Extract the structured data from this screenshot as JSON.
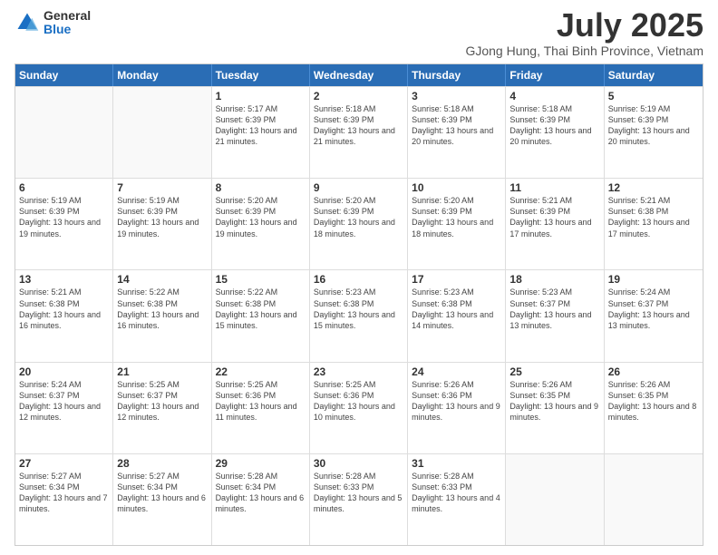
{
  "logo": {
    "general": "General",
    "blue": "Blue"
  },
  "title": {
    "month_year": "July 2025",
    "location": "GJong Hung, Thai Binh Province, Vietnam"
  },
  "header_days": [
    "Sunday",
    "Monday",
    "Tuesday",
    "Wednesday",
    "Thursday",
    "Friday",
    "Saturday"
  ],
  "weeks": [
    [
      {
        "day": "",
        "empty": true
      },
      {
        "day": "",
        "empty": true
      },
      {
        "day": "1",
        "sunrise": "5:17 AM",
        "sunset": "6:39 PM",
        "daylight": "13 hours and 21 minutes."
      },
      {
        "day": "2",
        "sunrise": "5:18 AM",
        "sunset": "6:39 PM",
        "daylight": "13 hours and 21 minutes."
      },
      {
        "day": "3",
        "sunrise": "5:18 AM",
        "sunset": "6:39 PM",
        "daylight": "13 hours and 20 minutes."
      },
      {
        "day": "4",
        "sunrise": "5:18 AM",
        "sunset": "6:39 PM",
        "daylight": "13 hours and 20 minutes."
      },
      {
        "day": "5",
        "sunrise": "5:19 AM",
        "sunset": "6:39 PM",
        "daylight": "13 hours and 20 minutes."
      }
    ],
    [
      {
        "day": "6",
        "sunrise": "5:19 AM",
        "sunset": "6:39 PM",
        "daylight": "13 hours and 19 minutes."
      },
      {
        "day": "7",
        "sunrise": "5:19 AM",
        "sunset": "6:39 PM",
        "daylight": "13 hours and 19 minutes."
      },
      {
        "day": "8",
        "sunrise": "5:20 AM",
        "sunset": "6:39 PM",
        "daylight": "13 hours and 19 minutes."
      },
      {
        "day": "9",
        "sunrise": "5:20 AM",
        "sunset": "6:39 PM",
        "daylight": "13 hours and 18 minutes."
      },
      {
        "day": "10",
        "sunrise": "5:20 AM",
        "sunset": "6:39 PM",
        "daylight": "13 hours and 18 minutes."
      },
      {
        "day": "11",
        "sunrise": "5:21 AM",
        "sunset": "6:39 PM",
        "daylight": "13 hours and 17 minutes."
      },
      {
        "day": "12",
        "sunrise": "5:21 AM",
        "sunset": "6:38 PM",
        "daylight": "13 hours and 17 minutes."
      }
    ],
    [
      {
        "day": "13",
        "sunrise": "5:21 AM",
        "sunset": "6:38 PM",
        "daylight": "13 hours and 16 minutes."
      },
      {
        "day": "14",
        "sunrise": "5:22 AM",
        "sunset": "6:38 PM",
        "daylight": "13 hours and 16 minutes."
      },
      {
        "day": "15",
        "sunrise": "5:22 AM",
        "sunset": "6:38 PM",
        "daylight": "13 hours and 15 minutes."
      },
      {
        "day": "16",
        "sunrise": "5:23 AM",
        "sunset": "6:38 PM",
        "daylight": "13 hours and 15 minutes."
      },
      {
        "day": "17",
        "sunrise": "5:23 AM",
        "sunset": "6:38 PM",
        "daylight": "13 hours and 14 minutes."
      },
      {
        "day": "18",
        "sunrise": "5:23 AM",
        "sunset": "6:37 PM",
        "daylight": "13 hours and 13 minutes."
      },
      {
        "day": "19",
        "sunrise": "5:24 AM",
        "sunset": "6:37 PM",
        "daylight": "13 hours and 13 minutes."
      }
    ],
    [
      {
        "day": "20",
        "sunrise": "5:24 AM",
        "sunset": "6:37 PM",
        "daylight": "13 hours and 12 minutes."
      },
      {
        "day": "21",
        "sunrise": "5:25 AM",
        "sunset": "6:37 PM",
        "daylight": "13 hours and 12 minutes."
      },
      {
        "day": "22",
        "sunrise": "5:25 AM",
        "sunset": "6:36 PM",
        "daylight": "13 hours and 11 minutes."
      },
      {
        "day": "23",
        "sunrise": "5:25 AM",
        "sunset": "6:36 PM",
        "daylight": "13 hours and 10 minutes."
      },
      {
        "day": "24",
        "sunrise": "5:26 AM",
        "sunset": "6:36 PM",
        "daylight": "13 hours and 9 minutes."
      },
      {
        "day": "25",
        "sunrise": "5:26 AM",
        "sunset": "6:35 PM",
        "daylight": "13 hours and 9 minutes."
      },
      {
        "day": "26",
        "sunrise": "5:26 AM",
        "sunset": "6:35 PM",
        "daylight": "13 hours and 8 minutes."
      }
    ],
    [
      {
        "day": "27",
        "sunrise": "5:27 AM",
        "sunset": "6:34 PM",
        "daylight": "13 hours and 7 minutes."
      },
      {
        "day": "28",
        "sunrise": "5:27 AM",
        "sunset": "6:34 PM",
        "daylight": "13 hours and 6 minutes."
      },
      {
        "day": "29",
        "sunrise": "5:28 AM",
        "sunset": "6:34 PM",
        "daylight": "13 hours and 6 minutes."
      },
      {
        "day": "30",
        "sunrise": "5:28 AM",
        "sunset": "6:33 PM",
        "daylight": "13 hours and 5 minutes."
      },
      {
        "day": "31",
        "sunrise": "5:28 AM",
        "sunset": "6:33 PM",
        "daylight": "13 hours and 4 minutes."
      },
      {
        "day": "",
        "empty": true
      },
      {
        "day": "",
        "empty": true
      }
    ]
  ]
}
